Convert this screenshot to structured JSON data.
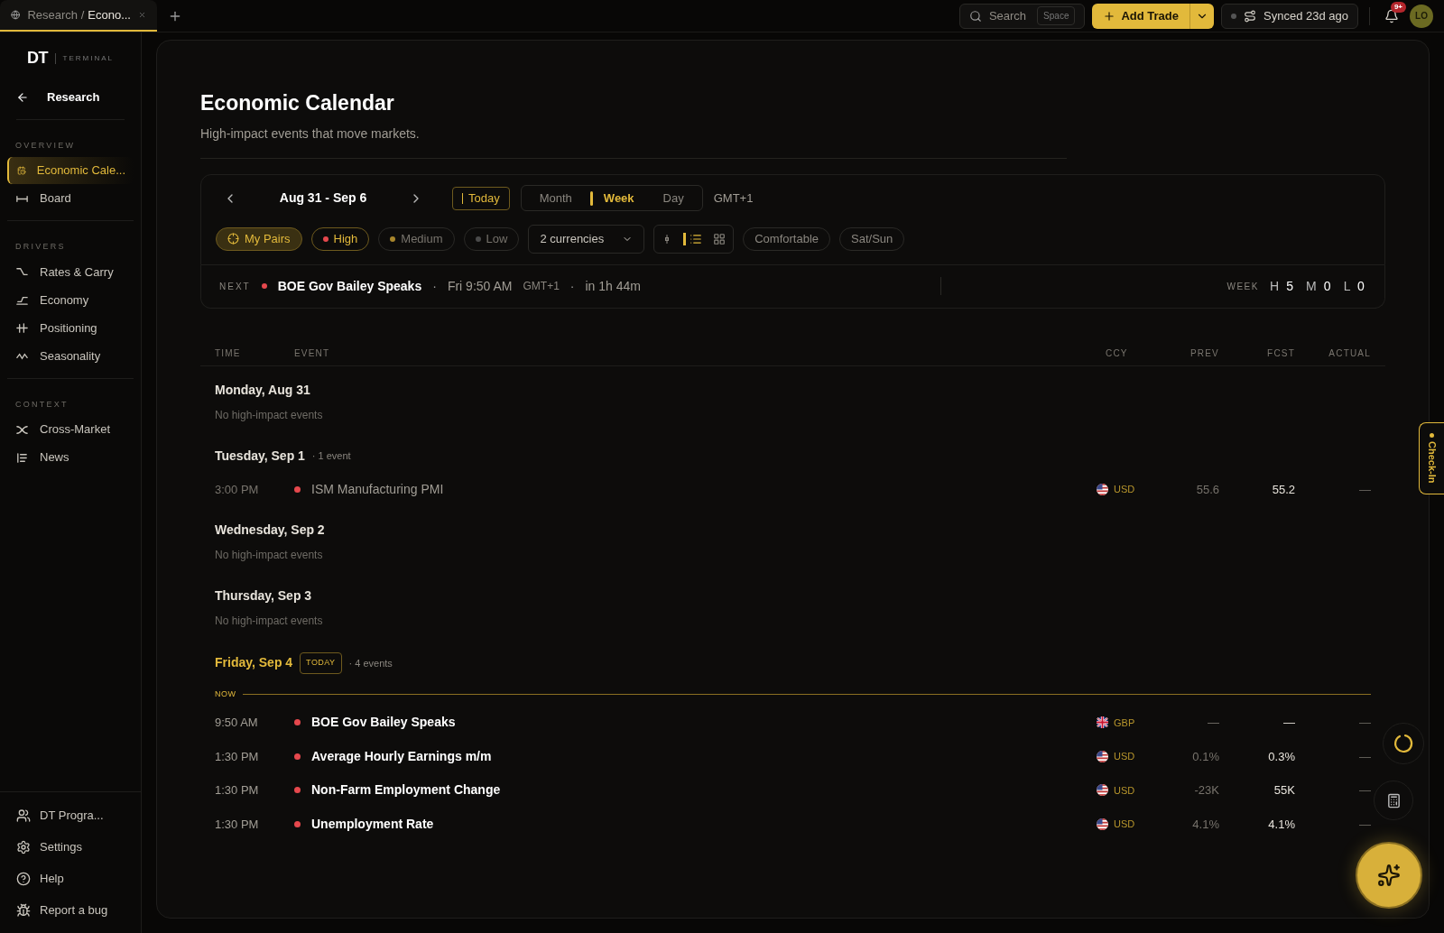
{
  "browser_tab": {
    "path": "Research /",
    "page": "Econo..."
  },
  "topbar": {
    "search": {
      "placeholder": "Search",
      "shortcut": "Space"
    },
    "add_trade": "Add Trade",
    "sync": "Synced 23d ago",
    "notifications": "9+",
    "avatar": "LO"
  },
  "sidebar": {
    "logo": "DT",
    "logo_sub": "TERMINAL",
    "back": "Research",
    "sections": [
      {
        "title": "OVERVIEW",
        "items": [
          {
            "label": "Economic Cale...",
            "selected": true
          },
          {
            "label": "Board",
            "selected": false
          }
        ]
      },
      {
        "title": "DRIVERS",
        "items": [
          {
            "label": "Rates & Carry",
            "selected": false
          },
          {
            "label": "Economy",
            "selected": false
          },
          {
            "label": "Positioning",
            "selected": false
          },
          {
            "label": "Seasonality",
            "selected": false
          }
        ]
      },
      {
        "title": "CONTEXT",
        "items": [
          {
            "label": "Cross-Market",
            "selected": false
          },
          {
            "label": "News",
            "selected": false
          }
        ]
      }
    ],
    "footer": [
      "DT Progra...",
      "Settings",
      "Help",
      "Report a bug"
    ]
  },
  "page": {
    "title": "Economic Calendar",
    "subtitle": "High-impact events that move markets."
  },
  "toolbar": {
    "range": "Aug 31 - Sep 6",
    "today": "Today",
    "views": [
      {
        "label": "Month",
        "selected": false
      },
      {
        "label": "Week",
        "selected": true
      },
      {
        "label": "Day",
        "selected": false
      }
    ],
    "timezone": "GMT+1",
    "filters": [
      {
        "kind": "pairs",
        "label": "My Pairs",
        "selected": true
      },
      {
        "kind": "impact",
        "label": "High",
        "selected": true,
        "color": "#e5484d"
      },
      {
        "kind": "impact",
        "label": "Medium",
        "selected": false,
        "color": "#a8862c"
      },
      {
        "kind": "impact",
        "label": "Low",
        "selected": false,
        "color": "#4a4a4a"
      }
    ],
    "currencies": "2 currencies",
    "layouts": [
      {
        "selected": false
      },
      {
        "selected": true
      },
      {
        "selected": false
      }
    ],
    "density": "Comfortable",
    "weekend": "Sat/Sun"
  },
  "next": {
    "label": "NEXT",
    "color": "#e5484d",
    "event": "BOE Gov Bailey Speaks",
    "separators": [
      "·",
      "·"
    ],
    "time": "Fri 9:50 AM",
    "timezone": "GMT+1",
    "countdown": "in 1h 44m",
    "week_label": "WEEK",
    "counts": [
      {
        "letter": "H",
        "value": "5"
      },
      {
        "letter": "M",
        "value": "0"
      },
      {
        "letter": "L",
        "value": "0"
      }
    ]
  },
  "table": {
    "columns": [
      "TIME",
      "EVENT",
      "CCY",
      "PREV",
      "FCST",
      "ACTUAL"
    ],
    "days": [
      {
        "title": "Monday, Aug 31",
        "today": false,
        "empty": "No high-impact events"
      },
      {
        "title": "Tuesday, Sep 1",
        "today": false,
        "count": "· 1 event",
        "events": [
          {
            "time": "3:00 PM",
            "name": "ISM Manufacturing PMI",
            "color": "#e5484d",
            "ccy": {
              "kind": "us",
              "code": "USD"
            },
            "prev": "55.6",
            "fcst": "55.2",
            "actual": "—",
            "past": true
          }
        ]
      },
      {
        "title": "Wednesday, Sep 2",
        "today": false,
        "empty": "No high-impact events"
      },
      {
        "title": "Thursday, Sep 3",
        "today": false,
        "empty": "No high-impact events"
      },
      {
        "title": "Friday, Sep 4",
        "today": true,
        "badge": "TODAY",
        "count": "· 4 events",
        "now": "NOW",
        "events": [
          {
            "time": "9:50 AM",
            "name": "BOE Gov Bailey Speaks",
            "color": "#e5484d",
            "ccy": {
              "kind": "gb",
              "code": "GBP"
            },
            "prev": "—",
            "fcst": "—",
            "actual": "—",
            "past": false
          },
          {
            "time": "1:30 PM",
            "name": "Average Hourly Earnings m/m",
            "color": "#e5484d",
            "ccy": {
              "kind": "us",
              "code": "USD"
            },
            "prev": "0.1%",
            "fcst": "0.3%",
            "actual": "—",
            "past": false
          },
          {
            "time": "1:30 PM",
            "name": "Non-Farm Employment Change",
            "color": "#e5484d",
            "ccy": {
              "kind": "us",
              "code": "USD"
            },
            "prev": "-23K",
            "fcst": "55K",
            "actual": "—",
            "past": false
          },
          {
            "time": "1:30 PM",
            "name": "Unemployment Rate",
            "color": "#e5484d",
            "ccy": {
              "kind": "us",
              "code": "USD"
            },
            "prev": "4.1%",
            "fcst": "4.1%",
            "actual": "—",
            "past": false
          }
        ]
      }
    ]
  },
  "check_in": "Check-In"
}
